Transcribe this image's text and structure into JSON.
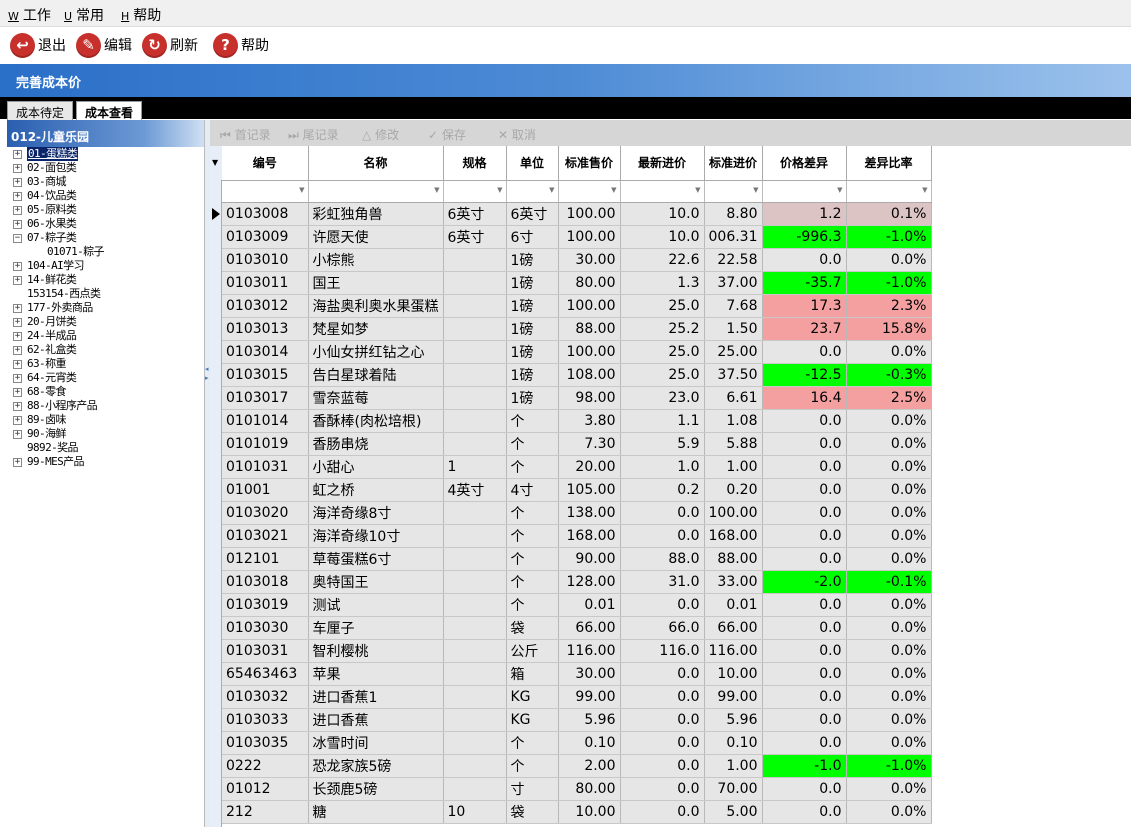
{
  "menubar": {
    "items": [
      {
        "key": "W",
        "label": "工作"
      },
      {
        "key": "U",
        "label": "常用"
      },
      {
        "key": "H",
        "label": "帮助"
      }
    ]
  },
  "toolbar": {
    "exit_label": "退出",
    "edit_label": "编辑",
    "refresh_label": "刷新",
    "help_label": "帮助"
  },
  "window_title": "完善成本价",
  "tabs": [
    {
      "label": "成本待定",
      "active": false
    },
    {
      "label": "成本查看",
      "active": true
    }
  ],
  "tree": {
    "root_label": "012-儿童乐园",
    "items": [
      {
        "label": "01-蛋糕类",
        "expander": "+",
        "level": 0,
        "selected": true
      },
      {
        "label": "02-面包类",
        "expander": "+",
        "level": 0
      },
      {
        "label": "03-商城",
        "expander": "+",
        "level": 0
      },
      {
        "label": "04-饮品类",
        "expander": "+",
        "level": 0
      },
      {
        "label": "05-原料类",
        "expander": "+",
        "level": 0
      },
      {
        "label": "06-水果类",
        "expander": "+",
        "level": 0
      },
      {
        "label": "07-粽子类",
        "expander": "-",
        "level": 0
      },
      {
        "label": "01071-粽子",
        "expander": "",
        "level": 1
      },
      {
        "label": "104-AI学习",
        "expander": "+",
        "level": 0
      },
      {
        "label": "14-鲜花类",
        "expander": "+",
        "level": 0
      },
      {
        "label": "153154-西点类",
        "expander": "",
        "level": 0
      },
      {
        "label": "177-外卖商品",
        "expander": "+",
        "level": 0
      },
      {
        "label": "20-月饼类",
        "expander": "+",
        "level": 0
      },
      {
        "label": "24-半成品",
        "expander": "+",
        "level": 0
      },
      {
        "label": "62-礼盒类",
        "expander": "+",
        "level": 0
      },
      {
        "label": "63-称重",
        "expander": "+",
        "level": 0
      },
      {
        "label": "64-元宵类",
        "expander": "+",
        "level": 0
      },
      {
        "label": "68-零食",
        "expander": "+",
        "level": 0
      },
      {
        "label": "88-小程序产品",
        "expander": "+",
        "level": 0
      },
      {
        "label": "89-卤味",
        "expander": "+",
        "level": 0
      },
      {
        "label": "90-海鲜",
        "expander": "+",
        "level": 0
      },
      {
        "label": "9892-奖品",
        "expander": "",
        "level": 0
      },
      {
        "label": "99-MES产品",
        "expander": "+",
        "level": 0
      }
    ]
  },
  "gridbar": {
    "first_label": "首记录",
    "last_label": "尾记录",
    "modify_label": "修改",
    "save_label": "保存",
    "cancel_label": "取消"
  },
  "colors": {
    "green": "#00ff00",
    "pink": "#f4a0a0",
    "rose": "#dcc4c4"
  },
  "table": {
    "columns": [
      "编号",
      "名称",
      "规格",
      "单位",
      "标准售价",
      "最新进价",
      "标准进价",
      "价格差异",
      "差异比率"
    ],
    "rows": [
      {
        "code": "0103008",
        "name": "彩虹独角兽",
        "spec": "6英寸",
        "unit": "6英寸",
        "std_price": "100.00",
        "latest_cost": "10.0",
        "std_cost": "8.80",
        "diff": "1.2",
        "ratio": "0.1%",
        "hl": "rose"
      },
      {
        "code": "0103009",
        "name": "许愿天使",
        "spec": "6英寸",
        "unit": "6寸",
        "std_price": "100.00",
        "latest_cost": "10.0",
        "std_cost": "006.31",
        "diff": "-996.3",
        "ratio": "-1.0%",
        "hl": "green"
      },
      {
        "code": "0103010",
        "name": "小棕熊",
        "spec": "",
        "unit": "1磅",
        "std_price": "30.00",
        "latest_cost": "22.6",
        "std_cost": "22.58",
        "diff": "0.0",
        "ratio": "0.0%",
        "hl": ""
      },
      {
        "code": "0103011",
        "name": "国王",
        "spec": "",
        "unit": "1磅",
        "std_price": "80.00",
        "latest_cost": "1.3",
        "std_cost": "37.00",
        "diff": "-35.7",
        "ratio": "-1.0%",
        "hl": "green"
      },
      {
        "code": "0103012",
        "name": "海盐奥利奥水果蛋糕",
        "spec": "",
        "unit": "1磅",
        "std_price": "100.00",
        "latest_cost": "25.0",
        "std_cost": "7.68",
        "diff": "17.3",
        "ratio": "2.3%",
        "hl": "pink"
      },
      {
        "code": "0103013",
        "name": "梵星如梦",
        "spec": "",
        "unit": "1磅",
        "std_price": "88.00",
        "latest_cost": "25.2",
        "std_cost": "1.50",
        "diff": "23.7",
        "ratio": "15.8%",
        "hl": "pink"
      },
      {
        "code": "0103014",
        "name": "小仙女拼红钻之心",
        "spec": "",
        "unit": "1磅",
        "std_price": "100.00",
        "latest_cost": "25.0",
        "std_cost": "25.00",
        "diff": "0.0",
        "ratio": "0.0%",
        "hl": ""
      },
      {
        "code": "0103015",
        "name": "告白星球着陆",
        "spec": "",
        "unit": "1磅",
        "std_price": "108.00",
        "latest_cost": "25.0",
        "std_cost": "37.50",
        "diff": "-12.5",
        "ratio": "-0.3%",
        "hl": "green"
      },
      {
        "code": "0103017",
        "name": "雪奈蓝莓",
        "spec": "",
        "unit": "1磅",
        "std_price": "98.00",
        "latest_cost": "23.0",
        "std_cost": "6.61",
        "diff": "16.4",
        "ratio": "2.5%",
        "hl": "pink"
      },
      {
        "code": "0101014",
        "name": "香酥棒(肉松培根)",
        "spec": "",
        "unit": "个",
        "std_price": "3.80",
        "latest_cost": "1.1",
        "std_cost": "1.08",
        "diff": "0.0",
        "ratio": "0.0%",
        "hl": ""
      },
      {
        "code": "0101019",
        "name": "香肠串烧",
        "spec": "",
        "unit": "个",
        "std_price": "7.30",
        "latest_cost": "5.9",
        "std_cost": "5.88",
        "diff": "0.0",
        "ratio": "0.0%",
        "hl": ""
      },
      {
        "code": "0101031",
        "name": "小甜心",
        "spec": "1",
        "unit": "个",
        "std_price": "20.00",
        "latest_cost": "1.0",
        "std_cost": "1.00",
        "diff": "0.0",
        "ratio": "0.0%",
        "hl": ""
      },
      {
        "code": "01001",
        "name": "虹之桥",
        "spec": "4英寸",
        "unit": "4寸",
        "std_price": "105.00",
        "latest_cost": "0.2",
        "std_cost": "0.20",
        "diff": "0.0",
        "ratio": "0.0%",
        "hl": ""
      },
      {
        "code": "0103020",
        "name": "海洋奇缘8寸",
        "spec": "",
        "unit": "个",
        "std_price": "138.00",
        "latest_cost": "0.0",
        "std_cost": "100.00",
        "diff": "0.0",
        "ratio": "0.0%",
        "hl": ""
      },
      {
        "code": "0103021",
        "name": "海洋奇缘10寸",
        "spec": "",
        "unit": "个",
        "std_price": "168.00",
        "latest_cost": "0.0",
        "std_cost": "168.00",
        "diff": "0.0",
        "ratio": "0.0%",
        "hl": ""
      },
      {
        "code": "012101",
        "name": "草莓蛋糕6寸",
        "spec": "",
        "unit": "个",
        "std_price": "90.00",
        "latest_cost": "88.0",
        "std_cost": "88.00",
        "diff": "0.0",
        "ratio": "0.0%",
        "hl": ""
      },
      {
        "code": "0103018",
        "name": "奥特国王",
        "spec": "",
        "unit": "个",
        "std_price": "128.00",
        "latest_cost": "31.0",
        "std_cost": "33.00",
        "diff": "-2.0",
        "ratio": "-0.1%",
        "hl": "green"
      },
      {
        "code": "0103019",
        "name": "测试",
        "spec": "",
        "unit": "个",
        "std_price": "0.01",
        "latest_cost": "0.0",
        "std_cost": "0.01",
        "diff": "0.0",
        "ratio": "0.0%",
        "hl": ""
      },
      {
        "code": "0103030",
        "name": "车厘子",
        "spec": "",
        "unit": "袋",
        "std_price": "66.00",
        "latest_cost": "66.0",
        "std_cost": "66.00",
        "diff": "0.0",
        "ratio": "0.0%",
        "hl": ""
      },
      {
        "code": "0103031",
        "name": "智利樱桃",
        "spec": "",
        "unit": "公斤",
        "std_price": "116.00",
        "latest_cost": "116.0",
        "std_cost": "116.00",
        "diff": "0.0",
        "ratio": "0.0%",
        "hl": ""
      },
      {
        "code": "65463463",
        "name": "苹果",
        "spec": "",
        "unit": "箱",
        "std_price": "30.00",
        "latest_cost": "0.0",
        "std_cost": "10.00",
        "diff": "0.0",
        "ratio": "0.0%",
        "hl": ""
      },
      {
        "code": "0103032",
        "name": "进口香蕉1",
        "spec": "",
        "unit": "KG",
        "std_price": "99.00",
        "latest_cost": "0.0",
        "std_cost": "99.00",
        "diff": "0.0",
        "ratio": "0.0%",
        "hl": ""
      },
      {
        "code": "0103033",
        "name": "进口香蕉",
        "spec": "",
        "unit": "KG",
        "std_price": "5.96",
        "latest_cost": "0.0",
        "std_cost": "5.96",
        "diff": "0.0",
        "ratio": "0.0%",
        "hl": ""
      },
      {
        "code": "0103035",
        "name": "冰雪时间",
        "spec": "",
        "unit": "个",
        "std_price": "0.10",
        "latest_cost": "0.0",
        "std_cost": "0.10",
        "diff": "0.0",
        "ratio": "0.0%",
        "hl": ""
      },
      {
        "code": "0222",
        "name": "恐龙家族5磅",
        "spec": "",
        "unit": "个",
        "std_price": "2.00",
        "latest_cost": "0.0",
        "std_cost": "1.00",
        "diff": "-1.0",
        "ratio": "-1.0%",
        "hl": "green"
      },
      {
        "code": "01012",
        "name": "长颈鹿5磅",
        "spec": "",
        "unit": "寸",
        "std_price": "80.00",
        "latest_cost": "0.0",
        "std_cost": "70.00",
        "diff": "0.0",
        "ratio": "0.0%",
        "hl": ""
      },
      {
        "code": "212",
        "name": "糖",
        "spec": "10",
        "unit": "袋",
        "std_price": "10.00",
        "latest_cost": "0.0",
        "std_cost": "5.00",
        "diff": "0.0",
        "ratio": "0.0%",
        "hl": ""
      }
    ]
  }
}
